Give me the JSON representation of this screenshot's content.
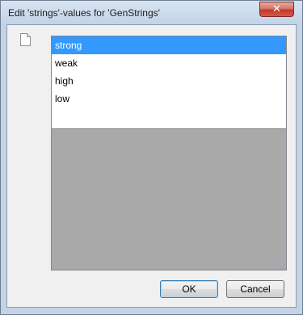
{
  "window": {
    "title": "Edit 'strings'-values for 'GenStrings'",
    "close_glyph": "✕"
  },
  "list": {
    "items": [
      {
        "label": "strong",
        "selected": true
      },
      {
        "label": "weak",
        "selected": false
      },
      {
        "label": "high",
        "selected": false
      },
      {
        "label": "low",
        "selected": false
      }
    ]
  },
  "buttons": {
    "ok_label": "OK",
    "cancel_label": "Cancel"
  },
  "icons": {
    "document": "document-icon",
    "close": "close-icon"
  },
  "colors": {
    "selection": "#3399ff",
    "list_empty_area": "#a9a9a9",
    "title_bar": "#c4d3e6",
    "close_button": "#c0392b"
  }
}
